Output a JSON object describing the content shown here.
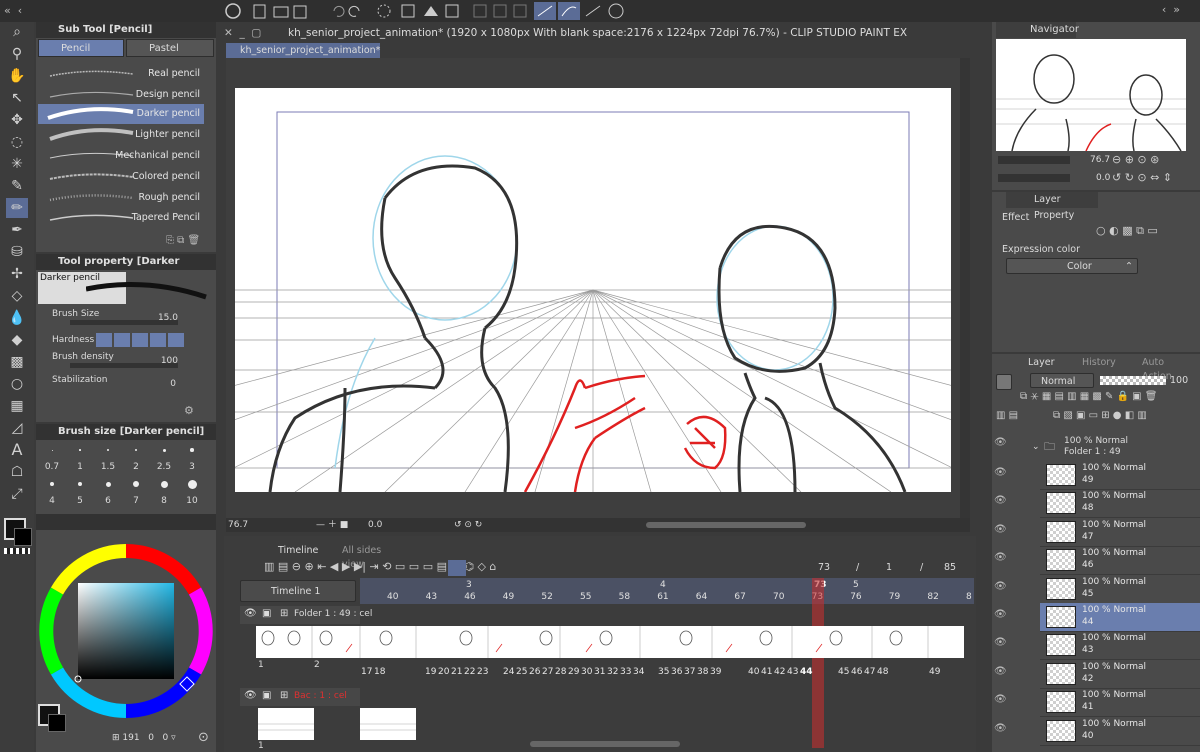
{
  "app_title": "kh_senior_project_animation* (1920 x 1080px With blank space:2176 x 1224px 72dpi 76.7%)  - CLIP STUDIO PAINT EX",
  "canvas_tab": "kh_senior_project_animation*",
  "sub_tool": {
    "header": "Sub Tool [Pencil]",
    "tabs": [
      "Pencil",
      "Pastel"
    ],
    "brushes": [
      "Real pencil",
      "Design pencil",
      "Darker pencil",
      "Lighter pencil",
      "Mechanical pencil",
      "Colored pencil",
      "Rough pencil",
      "Tapered Pencil"
    ],
    "selected": "Darker pencil"
  },
  "tool_property": {
    "header": "Tool property [Darker pencil]",
    "preview_label": "Darker pencil",
    "brush_size_label": "Brush Size",
    "brush_size_value": "15.0",
    "hardness_label": "Hardness",
    "brush_density_label": "Brush density",
    "brush_density_value": "100",
    "stabilization_label": "Stabilization",
    "stabilization_value": "0"
  },
  "brush_size": {
    "header": "Brush size [Darker pencil]",
    "sizes": [
      "0.7",
      "1",
      "1.5",
      "2",
      "2.5",
      "3",
      "4",
      "5",
      "6",
      "7",
      "8",
      "10"
    ]
  },
  "color_footer": {
    "count": "191",
    "a": "0",
    "b": "0"
  },
  "navigator": {
    "tab": "Navigator",
    "zoom": "76.7",
    "rotation": "0.0"
  },
  "layer_property": {
    "tab": "Layer Property",
    "effect_label": "Effect",
    "expression_color_label": "Expression color",
    "expression_color_value": "Color"
  },
  "layer_panel": {
    "tabs": [
      "Layer",
      "History",
      "Auto Action"
    ],
    "blend_mode": "Normal",
    "opacity": "100",
    "folder": {
      "line1": "100 % Normal",
      "line2": "Folder 1 : 49"
    },
    "layers": [
      {
        "opacity": "100 % Normal",
        "name": "49"
      },
      {
        "opacity": "100 % Normal",
        "name": "48"
      },
      {
        "opacity": "100 % Normal",
        "name": "47"
      },
      {
        "opacity": "100 % Normal",
        "name": "46"
      },
      {
        "opacity": "100 % Normal",
        "name": "45"
      },
      {
        "opacity": "100 % Normal",
        "name": "44"
      },
      {
        "opacity": "100 % Normal",
        "name": "43"
      },
      {
        "opacity": "100 % Normal",
        "name": "42"
      },
      {
        "opacity": "100 % Normal",
        "name": "41"
      },
      {
        "opacity": "100 % Normal",
        "name": "40"
      }
    ],
    "selected": "44"
  },
  "status_bar": {
    "zoom": "76.7",
    "rotation": "0.0"
  },
  "timeline": {
    "tabs": [
      "Timeline",
      "All sides view"
    ],
    "name": "Timeline 1",
    "current_frame": "73",
    "sep": "/",
    "start": "1",
    "end": "85",
    "ruler_labels": [
      "40",
      "43",
      "46",
      "49",
      "52",
      "55",
      "58",
      "61",
      "64",
      "67",
      "70",
      "73",
      "76",
      "79",
      "82",
      "8"
    ],
    "section_markers": [
      "3",
      "4",
      "73",
      "5"
    ],
    "track1_label": "Folder 1 : 49 : cel",
    "track2_label": "Bac : 1 : cel",
    "cel_numbers": [
      "1",
      "2"
    ],
    "frame_numbers": [
      "17",
      "18",
      "19",
      "20",
      "21",
      "22",
      "23",
      "24",
      "25",
      "26",
      "27",
      "28",
      "29",
      "30",
      "31",
      "32",
      "33",
      "34",
      "35",
      "36",
      "37",
      "38",
      "39",
      "40",
      "41",
      "42",
      "43",
      "44",
      "45",
      "46",
      "47",
      "48",
      "49"
    ],
    "bg_cel": "1"
  },
  "colors": {
    "accent": "#6a7eae",
    "playhead": "#c22f2f"
  }
}
